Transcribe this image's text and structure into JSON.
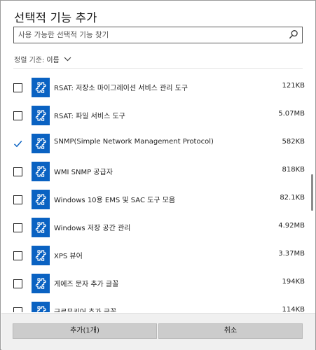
{
  "title": "선택적 기능 추가",
  "search": {
    "placeholder": "사용 가능한 선택적 기능 찾기"
  },
  "sort": {
    "label": "정렬 기준:",
    "value": "이름"
  },
  "features": [
    {
      "name": "RSAT: 저장소 마이그레이션 서비스 관리 도구",
      "size": "121KB",
      "checked": false
    },
    {
      "name": "RSAT: 파일 서비스 도구",
      "size": "5.07MB",
      "checked": false
    },
    {
      "name": "SNMP(Simple Network Management Protocol)",
      "size": "582KB",
      "checked": true
    },
    {
      "name": "WMI SNMP 공급자",
      "size": "818KB",
      "checked": false
    },
    {
      "name": "Windows 10용 EMS 및 SAC 도구 모음",
      "size": "82.1KB",
      "checked": false
    },
    {
      "name": "Windows 저장 공간 관리",
      "size": "4.92MB",
      "checked": false
    },
    {
      "name": "XPS 뷰어",
      "size": "3.37MB",
      "checked": false
    },
    {
      "name": "게에즈 문자 추가 글꼴",
      "size": "194KB",
      "checked": false
    },
    {
      "name": "구르무키어 추가 글꼴",
      "size": "114KB",
      "checked": false
    }
  ],
  "buttons": {
    "add": "추가(1개)",
    "cancel": "취소"
  },
  "colors": {
    "accent": "#0a62c2",
    "footer": "#f0f0f0",
    "button": "#cccccc"
  },
  "icons": {
    "search": "search-icon",
    "sort": "chevron-down-icon",
    "feature": "puzzle-icon",
    "check": "checkmark-icon"
  }
}
